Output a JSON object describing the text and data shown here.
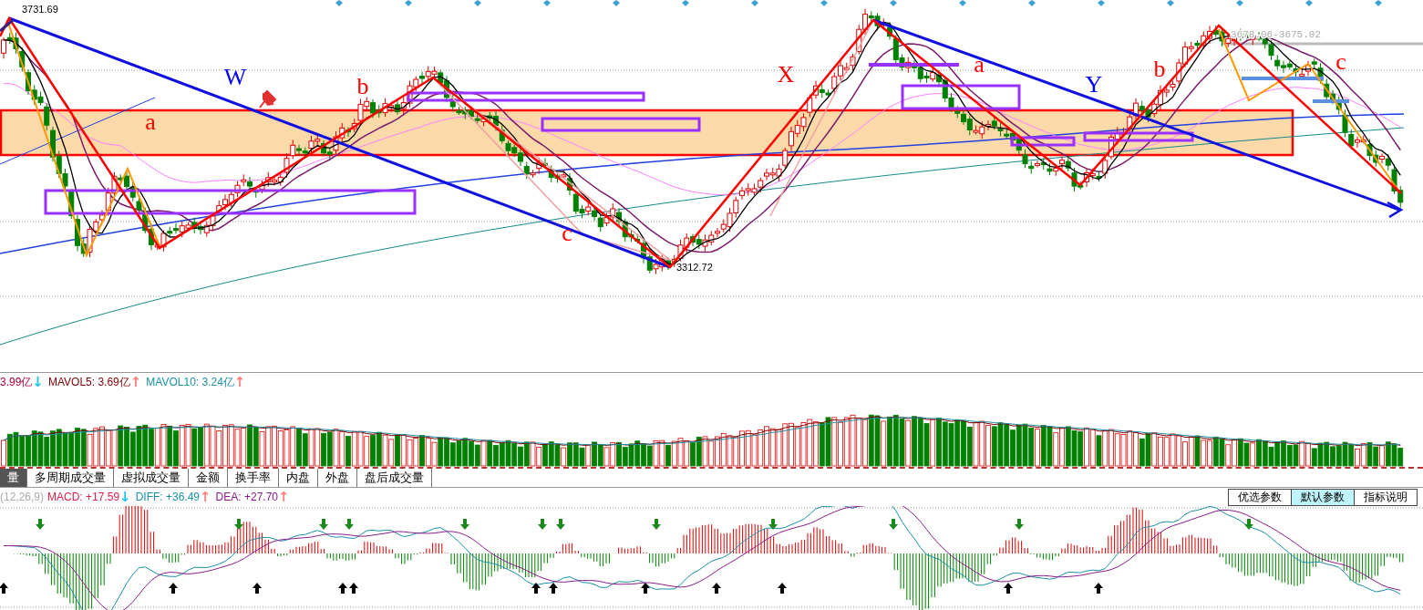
{
  "main_chart": {
    "price_labels": [
      {
        "kind": "high",
        "text": "3731.69"
      },
      {
        "kind": "low",
        "text": "3312.72"
      },
      {
        "kind": "range",
        "text": "3678.06-3675.02"
      }
    ],
    "wave_labels": [
      {
        "text": "W",
        "color": "#0000ff"
      },
      {
        "text": "a",
        "color": "#ff0000"
      },
      {
        "text": "b",
        "color": "#ff0000"
      },
      {
        "text": "c",
        "color": "#ff0000"
      },
      {
        "text": "X",
        "color": "#ff0000"
      },
      {
        "text": "a",
        "color": "#ff0000"
      },
      {
        "text": "Y",
        "color": "#0000ff"
      },
      {
        "text": "b",
        "color": "#ff0000"
      },
      {
        "text": "c",
        "color": "#ff0000"
      }
    ]
  },
  "volume": {
    "readings": [
      {
        "text": "3.99亿",
        "arrow": {
          "text": "↓",
          "color": "#20c8e8"
        },
        "color": "#b0003a"
      },
      {
        "text": "MAVOL5: 3.69亿",
        "arrow": {
          "text": "↑",
          "color": "#ff7f7f"
        },
        "color": "#800000"
      },
      {
        "text": "MAVOL10: 3.24亿",
        "arrow": {
          "text": "↑",
          "color": "#ff7f7f"
        },
        "color": "#1a8fa8"
      }
    ]
  },
  "tabs": [
    {
      "label": "量",
      "selected": true
    },
    {
      "label": "多周期成交量",
      "selected": false
    },
    {
      "label": "虚拟成交量",
      "selected": false
    },
    {
      "label": "金额",
      "selected": false
    },
    {
      "label": "换手率",
      "selected": false
    },
    {
      "label": "内盘",
      "selected": false
    },
    {
      "label": "外盘",
      "selected": false
    },
    {
      "label": "盘后成交量",
      "selected": false
    }
  ],
  "macd": {
    "params": "(12,26,9)",
    "readings": [
      {
        "text": "MACD: +17.59",
        "arrow": {
          "text": "↓",
          "color": "#20c8e8"
        },
        "color": "#e0204a"
      },
      {
        "text": "DIFF: +36.49",
        "arrow": {
          "text": "↑",
          "color": "#ff7f7f"
        },
        "color": "#1a8fa8"
      },
      {
        "text": "DEA: +27.70",
        "arrow": {
          "text": "↑",
          "color": "#ff7f7f"
        },
        "color": "#8b1a8b"
      }
    ],
    "buttons": [
      {
        "label": "优选参数",
        "selected": false
      },
      {
        "label": "默认参数",
        "selected": true
      },
      {
        "label": "指标说明",
        "selected": false
      }
    ]
  }
}
